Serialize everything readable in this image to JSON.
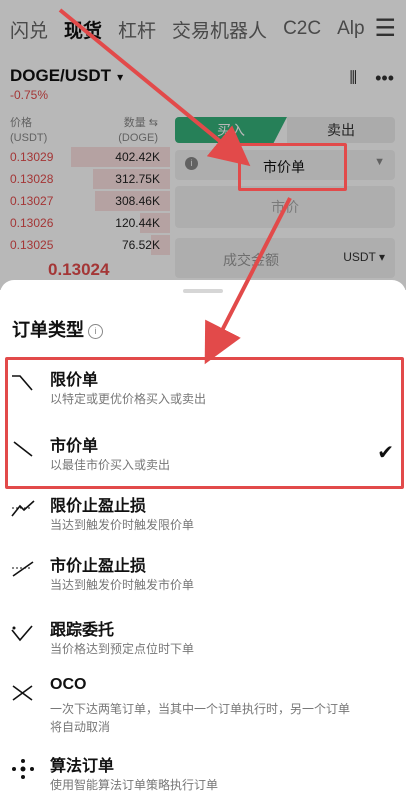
{
  "top_nav": {
    "tabs": [
      "闪兑",
      "现货",
      "杠杆",
      "交易机器人",
      "C2C",
      "Alp"
    ],
    "active_index": 1,
    "menu_icon": "hamburger-icon"
  },
  "pair": {
    "symbol": "DOGE/USDT",
    "change": "-0.75%"
  },
  "orderbook": {
    "price_header": [
      "价格",
      "(USDT)"
    ],
    "qty_header": [
      "数量 ⇆",
      "(DOGE)"
    ],
    "rows": [
      {
        "price": "0.13029",
        "qty": "402.42K",
        "depth": 0.9
      },
      {
        "price": "0.13028",
        "qty": "312.75K",
        "depth": 0.7
      },
      {
        "price": "0.13027",
        "qty": "308.46K",
        "depth": 0.68
      },
      {
        "price": "0.13026",
        "qty": "120.44K",
        "depth": 0.27
      },
      {
        "price": "0.13025",
        "qty": "76.52K",
        "depth": 0.17
      }
    ],
    "last_price": "0.13024"
  },
  "trade_form": {
    "buy_label": "买入",
    "sell_label": "卖出",
    "order_type": "市价单",
    "price_placeholder": "市价",
    "amount_placeholder": "成交金额",
    "amount_unit": "USDT"
  },
  "sheet": {
    "title": "订单类型",
    "items": [
      {
        "title": "限价单",
        "desc": "以特定或更优价格买入或卖出",
        "icon": "limit-order-icon",
        "selected": false
      },
      {
        "title": "市价单",
        "desc": "以最佳市价买入或卖出",
        "icon": "market-order-icon",
        "selected": true
      },
      {
        "title": "限价止盈止损",
        "desc": "当达到触发价时触发限价单",
        "icon": "limit-tp-sl-icon",
        "selected": false
      },
      {
        "title": "市价止盈止损",
        "desc": "当达到触发价时触发市价单",
        "icon": "market-tp-sl-icon",
        "selected": false
      },
      {
        "title": "跟踪委托",
        "desc": "当价格达到预定点位时下单",
        "icon": "trailing-order-icon",
        "selected": false
      },
      {
        "title": "OCO",
        "desc": "一次下达两笔订单，当其中一个订单执行时，另一个订单",
        "desc2": "将自动取消",
        "icon": "oco-icon",
        "selected": false
      },
      {
        "title": "算法订单",
        "desc": "使用智能算法订单策略执行订单",
        "icon": "algo-order-icon",
        "selected": false
      }
    ]
  },
  "colors": {
    "accent_red": "#e34b4b",
    "buy_green": "#35b27a",
    "annotation_red": "#e24a4a"
  }
}
